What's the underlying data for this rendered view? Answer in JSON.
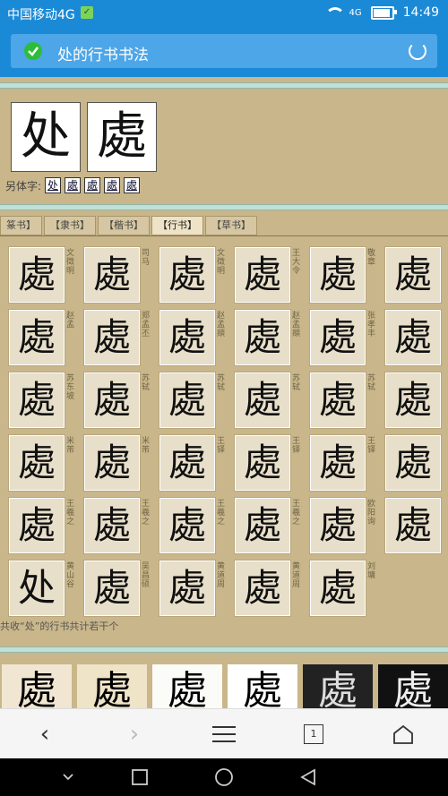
{
  "status": {
    "carrier": "中国移动4G",
    "time": "14:49",
    "network": "4G",
    "battery_level": 0.85
  },
  "address_bar": {
    "title": "处的行书书法"
  },
  "character": {
    "simplified": "处",
    "traditional": "處",
    "variants_label": "另体字:",
    "variants": [
      "处",
      "處",
      "處",
      "處",
      "處"
    ]
  },
  "tabs": [
    "篆书",
    "隶书",
    "楷书",
    "行书",
    "草书"
  ],
  "tabs_display": [
    "篆书】",
    "【隶书】",
    "【楷书】",
    "【行书】",
    "【草书】"
  ],
  "active_tab": "【行书】",
  "grid": [
    {
      "glyph": "處",
      "author": "文徵明"
    },
    {
      "glyph": "處",
      "author": "司马"
    },
    {
      "glyph": "處",
      "author": "文徵明"
    },
    {
      "glyph": "處",
      "author": "王大令"
    },
    {
      "glyph": "處",
      "author": "敬章"
    },
    {
      "glyph": "處",
      "author": ""
    },
    {
      "glyph": "處",
      "author": "赵孟"
    },
    {
      "glyph": "處",
      "author": "郑孟丕"
    },
    {
      "glyph": "處",
      "author": "赵孟頫"
    },
    {
      "glyph": "處",
      "author": "赵孟頫"
    },
    {
      "glyph": "處",
      "author": "张孝丰"
    },
    {
      "glyph": "處",
      "author": ""
    },
    {
      "glyph": "處",
      "author": "苏东坡"
    },
    {
      "glyph": "處",
      "author": "苏轼"
    },
    {
      "glyph": "處",
      "author": "苏轼"
    },
    {
      "glyph": "處",
      "author": "苏轼"
    },
    {
      "glyph": "處",
      "author": "苏轼"
    },
    {
      "glyph": "處",
      "author": ""
    },
    {
      "glyph": "處",
      "author": "米芾"
    },
    {
      "glyph": "處",
      "author": "米芾"
    },
    {
      "glyph": "處",
      "author": "王铎"
    },
    {
      "glyph": "處",
      "author": "王铎"
    },
    {
      "glyph": "處",
      "author": "王铎"
    },
    {
      "glyph": "處",
      "author": ""
    },
    {
      "glyph": "處",
      "author": "王羲之"
    },
    {
      "glyph": "處",
      "author": "王羲之"
    },
    {
      "glyph": "處",
      "author": "王羲之"
    },
    {
      "glyph": "處",
      "author": "王羲之"
    },
    {
      "glyph": "處",
      "author": "欧阳询"
    },
    {
      "glyph": "處",
      "author": ""
    },
    {
      "glyph": "处",
      "author": "黄山谷"
    },
    {
      "glyph": "處",
      "author": "吴昌硕"
    },
    {
      "glyph": "處",
      "author": "黄道周"
    },
    {
      "glyph": "處",
      "author": "黄道周"
    },
    {
      "glyph": "處",
      "author": "刘墉"
    }
  ],
  "caption": "共收“处”的行书共计若干个",
  "gallery": [
    "處",
    "處",
    "處",
    "處",
    "處",
    "處"
  ],
  "nav": {
    "back": "‹",
    "forward": "›",
    "tab_count": "1"
  }
}
